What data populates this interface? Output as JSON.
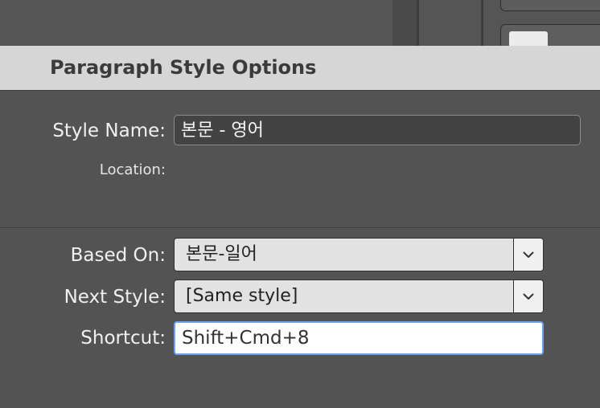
{
  "dialog": {
    "title": "Paragraph Style Options"
  },
  "fields": {
    "style_name_label": "Style Name:",
    "style_name_value": "본문 - 영어",
    "location_label": "Location:",
    "based_on_label": "Based On:",
    "based_on_value": "본문-일어",
    "next_style_label": "Next Style:",
    "next_style_value": "[Same style]",
    "shortcut_label": "Shortcut:",
    "shortcut_value": "Shift+Cmd+8"
  },
  "colors": {
    "panel_bg": "#535353",
    "title_bar": "#d6d6d6",
    "focus_ring": "#6aa2f5"
  }
}
